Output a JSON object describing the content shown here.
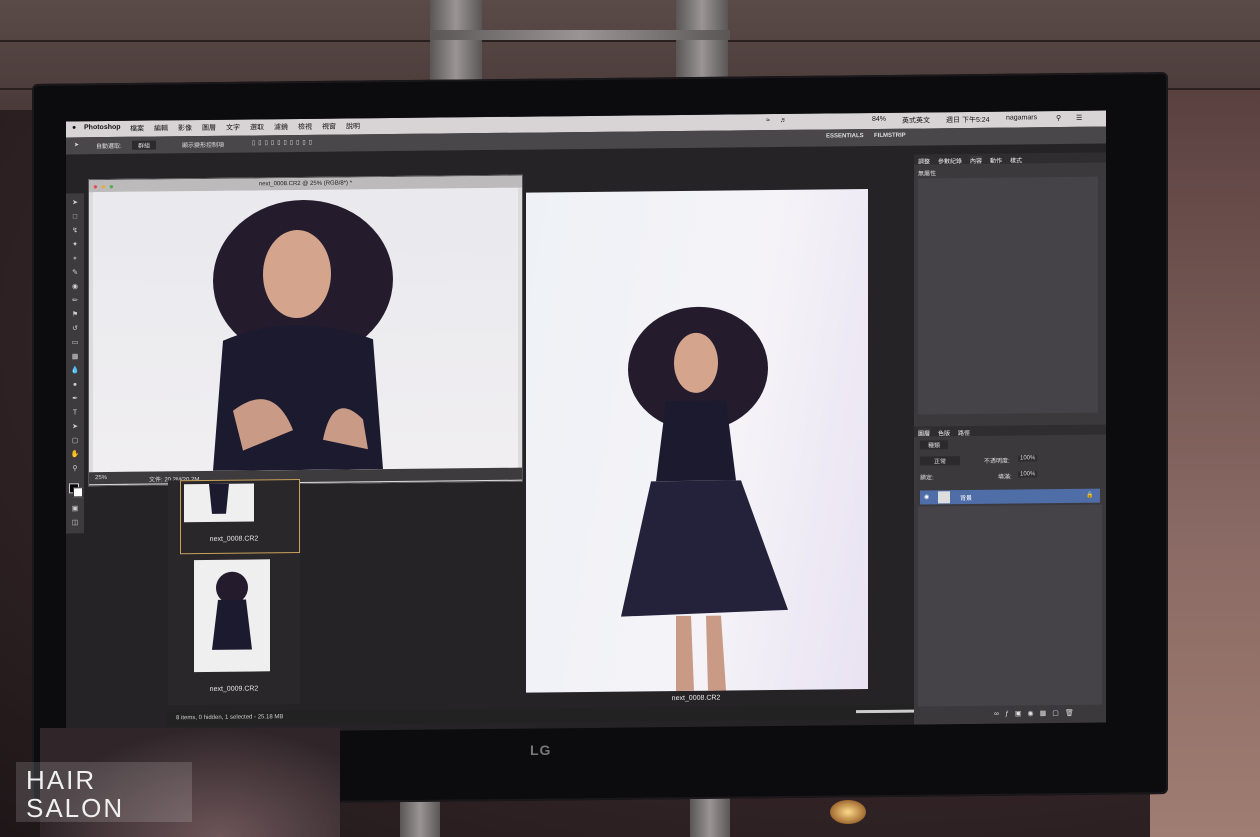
{
  "menubar": {
    "app": "Photoshop",
    "items": [
      "檔案",
      "編輯",
      "影像",
      "圖層",
      "文字",
      "選取",
      "濾鏡",
      "檢視",
      "視窗",
      "說明"
    ],
    "status_battery": "84%",
    "input_method": "英式英文",
    "clock": "週日 下午5:24",
    "user": "nagamars",
    "user_field": "mars"
  },
  "options_bar": {
    "auto_select_label": "自動選取:",
    "auto_select_value": "群組",
    "show_transform_label": "顯示變形控制項"
  },
  "document": {
    "title": "next_0008.CR2 @ 25% (RGB/8*) *",
    "zoom": "25%",
    "file_info": "文件: 20.2M/20.2M"
  },
  "workspace_tabs": [
    "ESSENTIALS",
    "FILMSTRIP"
  ],
  "filmstrip": {
    "items": [
      {
        "label": "next_0008.CR2"
      },
      {
        "label": "next_0009.CR2"
      }
    ]
  },
  "preview": {
    "label": "next_0008.CR2"
  },
  "bottom_status": "8 items, 0 hidden, 1 selected - 25.18 MB",
  "panels": {
    "top_tabs": [
      "調整",
      "參數紀錄",
      "內容",
      "動作",
      "樣式"
    ],
    "properties_empty": "無屬性",
    "layers_tabs": [
      "圖層",
      "色版",
      "路徑"
    ],
    "filter_kind": "種類",
    "blend_mode": "正常",
    "opacity_label": "不透明度:",
    "opacity_value": "100%",
    "lock_label": "鎖定:",
    "fill_label": "填滿:",
    "fill_value": "100%",
    "layer_name": "背景"
  },
  "monitor_brand": "LG",
  "watermark": "HAIR SALON"
}
